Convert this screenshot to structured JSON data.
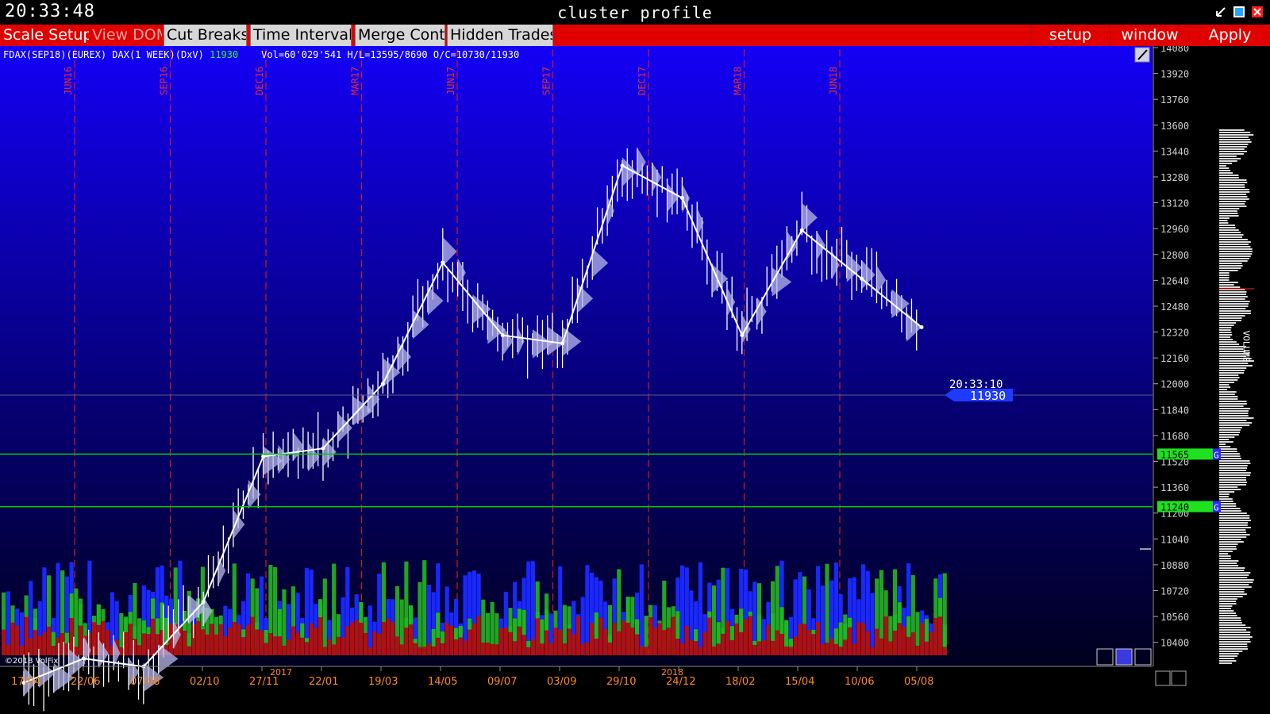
{
  "clock": "20:33:48",
  "window_title": "cluster profile",
  "window_controls": [
    "minimize-icon",
    "restore-icon",
    "close-icon"
  ],
  "toolbar": {
    "left": [
      "Scale Setup",
      "View DOM",
      "Cut Breaks",
      "Time Interval",
      "Merge Contr",
      "Hidden Trades"
    ],
    "right": [
      "setup",
      "window",
      "Apply"
    ]
  },
  "info_line": {
    "instrument": "FDAX(SEP18)(EUREX) DAX(1 WEEK)(DxV)",
    "last": "11930",
    "stats": "Vol=60'029'541 H/L=13595/8690 O/C=10730/11930"
  },
  "colors": {
    "background_top": "#1400f5",
    "background_bottom": "#00001e",
    "toolbar": "#e00000",
    "level_line": "#00d000",
    "price_tag": "#1e3cff"
  },
  "y_ticks": [
    "14080",
    "13920",
    "13760",
    "13600",
    "13440",
    "13280",
    "13120",
    "12960",
    "12800",
    "12640",
    "12480",
    "12320",
    "12160",
    "12000",
    "11840",
    "11680",
    "11520",
    "11360",
    "11200",
    "11040",
    "10880",
    "10720",
    "10560",
    "10400"
  ],
  "expiries": [
    "JUN16",
    "SEP16",
    "DEC16",
    "MAR17",
    "JUN17",
    "SEP17",
    "DEC17",
    "MAR18",
    "JUN18"
  ],
  "x_ticks": [
    "17/04",
    "22/06",
    "07/08",
    "02/10",
    "27/11",
    "22/01",
    "19/03",
    "14/05",
    "09/07",
    "03/09",
    "29/10",
    "24/12",
    "18/02",
    "15/04",
    "10/06",
    "05/08"
  ],
  "year_labels": [
    "2017",
    "2018"
  ],
  "levels": [
    "11565",
    "11240"
  ],
  "level_flag": "G",
  "current_time": "20:33:10",
  "current_price": "11930",
  "volume_label": "VOLUME",
  "copyright": "©2018 VolFix",
  "chart_data": {
    "type": "line",
    "title": "cluster profile",
    "instrument": "FDAX(SEP18)(EUREX) DAX(1 WEEK)(DxV)",
    "ylim": [
      10320,
      14080
    ],
    "x": [
      "17/04",
      "22/06",
      "07/08",
      "02/10",
      "27/11",
      "22/01",
      "19/03",
      "14/05",
      "09/07",
      "03/09",
      "29/10",
      "24/12",
      "18/02",
      "15/04",
      "10/06",
      "05/08"
    ],
    "series": [
      {
        "values": [
          10150,
          10300,
          10250,
          10650,
          11550,
          11600,
          12000,
          12750,
          12300,
          12250,
          13350,
          13150,
          12300,
          12950,
          12650,
          12350
        ]
      }
    ],
    "levels": [
      11565,
      11240
    ],
    "last_price": 11930
  }
}
